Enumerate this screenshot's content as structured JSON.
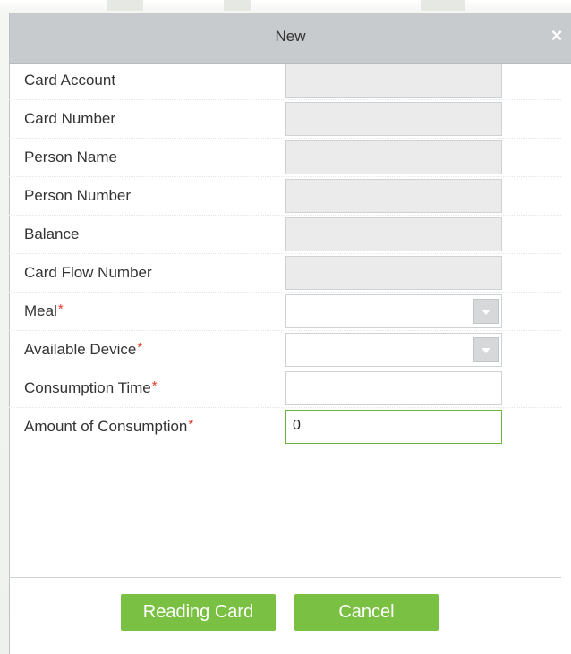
{
  "dialog": {
    "title": "New",
    "close_glyph": "×"
  },
  "form": {
    "fields": [
      {
        "label": "Card Account",
        "value": "",
        "required": false
      },
      {
        "label": "Card Number",
        "value": "",
        "required": false
      },
      {
        "label": "Person Name",
        "value": "",
        "required": false
      },
      {
        "label": "Person Number",
        "value": "",
        "required": false
      },
      {
        "label": "Balance",
        "value": "",
        "required": false
      },
      {
        "label": "Card Flow Number",
        "value": "",
        "required": false
      },
      {
        "label": "Meal",
        "value": "",
        "required": true
      },
      {
        "label": "Available Device",
        "value": "",
        "required": true
      },
      {
        "label": "Consumption Time",
        "value": "",
        "required": true
      },
      {
        "label": "Amount of Consumption",
        "value": "0",
        "required": true
      }
    ],
    "required_marker": "*"
  },
  "buttons": {
    "reading_card": "Reading Card",
    "cancel": "Cancel"
  },
  "colors": {
    "accent_green": "#7ac143",
    "focus_border": "#6cb33f",
    "required_red": "#e23b2c",
    "titlebar_gray": "#c8cbcd",
    "disabled_field": "#ebebeb"
  },
  "icons": {
    "close": "close-icon",
    "dropdown": "chevron-down-icon"
  }
}
